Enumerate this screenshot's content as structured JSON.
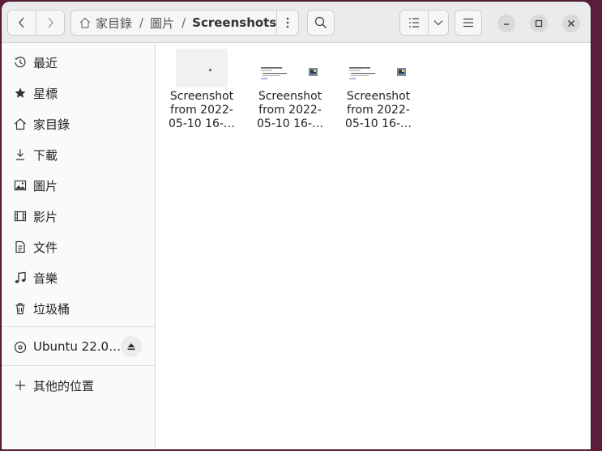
{
  "headerbar": {
    "breadcrumbs": [
      {
        "label": "家目錄",
        "icon": "home-icon"
      },
      {
        "label": "圖片"
      },
      {
        "label": "Screenshots"
      }
    ]
  },
  "sidebar": {
    "items": [
      {
        "label": "最近",
        "icon": "clock-icon"
      },
      {
        "label": "星標",
        "icon": "star-icon"
      },
      {
        "label": "家目錄",
        "icon": "home-icon"
      },
      {
        "label": "下載",
        "icon": "download-icon"
      },
      {
        "label": "圖片",
        "icon": "image-icon"
      },
      {
        "label": "影片",
        "icon": "film-icon"
      },
      {
        "label": "文件",
        "icon": "document-icon"
      },
      {
        "label": "音樂",
        "icon": "music-icon"
      },
      {
        "label": "垃圾桶",
        "icon": "trash-icon"
      }
    ],
    "drive": {
      "label": "Ubuntu 22.0…",
      "icon": "disc-icon"
    },
    "other": {
      "label": "其他的位置",
      "icon": "plus-icon"
    }
  },
  "files": [
    {
      "line1": "Screenshot",
      "line2": "from 2022-",
      "line3": "05-10 16-…",
      "thumb": "blank"
    },
    {
      "line1": "Screenshot",
      "line2": "from 2022-",
      "line3": "05-10 16-…",
      "thumb": "shot"
    },
    {
      "line1": "Screenshot",
      "line2": "from 2022-",
      "line3": "05-10 16-…",
      "thumb": "shot"
    }
  ]
}
